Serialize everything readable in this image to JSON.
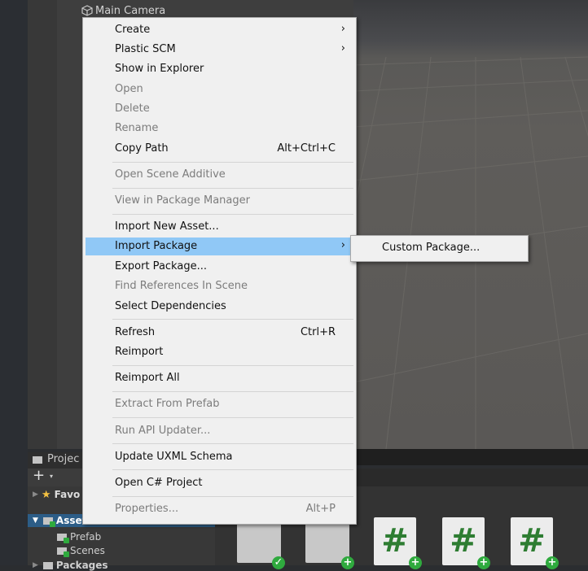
{
  "hierarchy": {
    "camera_label": "Main Camera"
  },
  "context_menu": {
    "items": [
      {
        "label": "Create",
        "shortcut": "",
        "submenu": true,
        "disabled": false
      },
      {
        "label": "Plastic SCM",
        "shortcut": "",
        "submenu": true,
        "disabled": false
      },
      {
        "label": "Show in Explorer",
        "shortcut": "",
        "disabled": false
      },
      {
        "label": "Open",
        "shortcut": "",
        "disabled": true
      },
      {
        "label": "Delete",
        "shortcut": "",
        "disabled": true
      },
      {
        "label": "Rename",
        "shortcut": "",
        "disabled": true
      },
      {
        "label": "Copy Path",
        "shortcut": "Alt+Ctrl+C",
        "disabled": false
      },
      {
        "label": "Open Scene Additive",
        "shortcut": "",
        "disabled": true
      },
      {
        "label": "View in Package Manager",
        "shortcut": "",
        "disabled": true
      },
      {
        "label": "Import New Asset...",
        "shortcut": "",
        "disabled": false
      },
      {
        "label": "Import Package",
        "shortcut": "",
        "submenu": true,
        "highlighted": true,
        "disabled": false
      },
      {
        "label": "Export Package...",
        "shortcut": "",
        "disabled": false
      },
      {
        "label": "Find References In Scene",
        "shortcut": "",
        "disabled": true
      },
      {
        "label": "Select Dependencies",
        "shortcut": "",
        "disabled": false
      },
      {
        "label": "Refresh",
        "shortcut": "Ctrl+R",
        "disabled": false
      },
      {
        "label": "Reimport",
        "shortcut": "",
        "disabled": false
      },
      {
        "label": "Reimport All",
        "shortcut": "",
        "disabled": false
      },
      {
        "label": "Extract From Prefab",
        "shortcut": "",
        "disabled": true
      },
      {
        "label": "Run API Updater...",
        "shortcut": "",
        "disabled": true
      },
      {
        "label": "Update UXML Schema",
        "shortcut": "",
        "disabled": false
      },
      {
        "label": "Open C# Project",
        "shortcut": "",
        "disabled": false
      },
      {
        "label": "Properties...",
        "shortcut": "Alt+P",
        "disabled": true
      }
    ],
    "submenu_arrow": "›"
  },
  "import_submenu": {
    "items": [
      "Custom Package..."
    ]
  },
  "project_panel": {
    "tab_label": "Projec",
    "add_button": "+",
    "dropdown_glyph": "▾",
    "favorites_label": "Favo",
    "assets_label": "Assets",
    "folders": [
      "Prefab",
      "Scenes"
    ],
    "packages_label": "Packages"
  },
  "asset_grid": {
    "script_glyph": "#",
    "badge_glyph": "+"
  },
  "colors": {
    "highlight": "#90c8f6",
    "menu_bg": "#f0f0f0",
    "assets_selected": "#2c5d87",
    "badge_green": "#2faa3e",
    "script_green": "#2e7d32"
  }
}
